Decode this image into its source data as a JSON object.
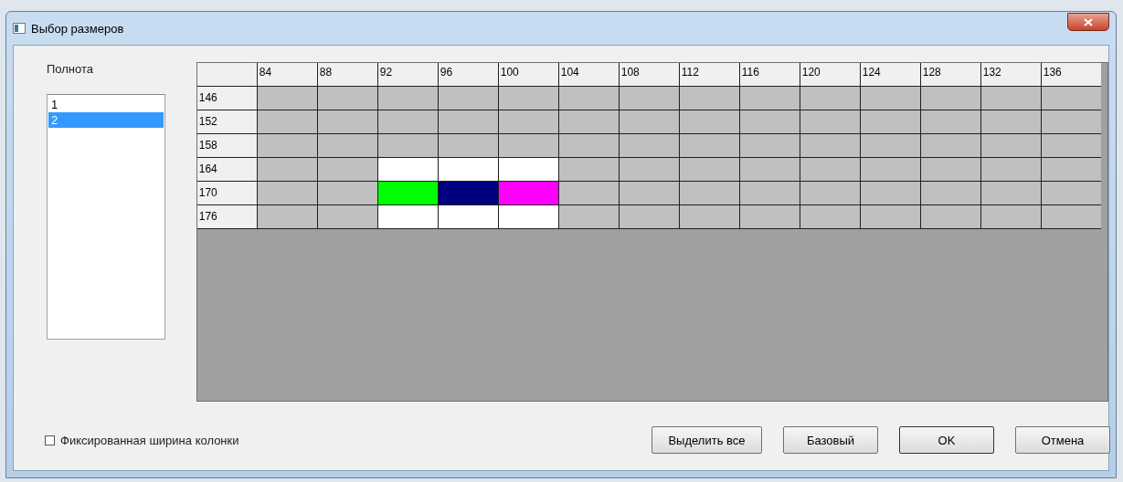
{
  "window": {
    "title": "Выбор размеров"
  },
  "fullness": {
    "label": "Полнота",
    "items": [
      {
        "label": "1",
        "selected": false
      },
      {
        "label": "2",
        "selected": true
      }
    ]
  },
  "grid": {
    "columns": [
      "84",
      "88",
      "92",
      "96",
      "100",
      "104",
      "108",
      "112",
      "116",
      "120",
      "124",
      "128",
      "132",
      "136"
    ],
    "rows": [
      {
        "label": "146",
        "cells": [
          {
            "color": "#c0c0c0"
          },
          {
            "color": "#c0c0c0"
          },
          {
            "color": "#c0c0c0"
          },
          {
            "color": "#c0c0c0"
          },
          {
            "color": "#c0c0c0"
          },
          {
            "color": "#c0c0c0"
          },
          {
            "color": "#c0c0c0"
          },
          {
            "color": "#c0c0c0"
          },
          {
            "color": "#c0c0c0"
          },
          {
            "color": "#c0c0c0"
          },
          {
            "color": "#c0c0c0"
          },
          {
            "color": "#c0c0c0"
          },
          {
            "color": "#c0c0c0"
          },
          {
            "color": "#c0c0c0"
          }
        ]
      },
      {
        "label": "152",
        "cells": [
          {
            "color": "#c0c0c0"
          },
          {
            "color": "#c0c0c0"
          },
          {
            "color": "#c0c0c0"
          },
          {
            "color": "#c0c0c0"
          },
          {
            "color": "#c0c0c0"
          },
          {
            "color": "#c0c0c0"
          },
          {
            "color": "#c0c0c0"
          },
          {
            "color": "#c0c0c0"
          },
          {
            "color": "#c0c0c0"
          },
          {
            "color": "#c0c0c0"
          },
          {
            "color": "#c0c0c0"
          },
          {
            "color": "#c0c0c0"
          },
          {
            "color": "#c0c0c0"
          },
          {
            "color": "#c0c0c0"
          }
        ]
      },
      {
        "label": "158",
        "cells": [
          {
            "color": "#c0c0c0"
          },
          {
            "color": "#c0c0c0"
          },
          {
            "color": "#c0c0c0"
          },
          {
            "color": "#c0c0c0"
          },
          {
            "color": "#c0c0c0"
          },
          {
            "color": "#c0c0c0"
          },
          {
            "color": "#c0c0c0"
          },
          {
            "color": "#c0c0c0"
          },
          {
            "color": "#c0c0c0"
          },
          {
            "color": "#c0c0c0"
          },
          {
            "color": "#c0c0c0"
          },
          {
            "color": "#c0c0c0"
          },
          {
            "color": "#c0c0c0"
          },
          {
            "color": "#c0c0c0"
          }
        ]
      },
      {
        "label": "164",
        "cells": [
          {
            "color": "#c0c0c0"
          },
          {
            "color": "#c0c0c0"
          },
          {
            "color": "#ffffff"
          },
          {
            "color": "#ffffff"
          },
          {
            "color": "#ffffff"
          },
          {
            "color": "#c0c0c0"
          },
          {
            "color": "#c0c0c0"
          },
          {
            "color": "#c0c0c0"
          },
          {
            "color": "#c0c0c0"
          },
          {
            "color": "#c0c0c0"
          },
          {
            "color": "#c0c0c0"
          },
          {
            "color": "#c0c0c0"
          },
          {
            "color": "#c0c0c0"
          },
          {
            "color": "#c0c0c0"
          }
        ]
      },
      {
        "label": "170",
        "cells": [
          {
            "color": "#c0c0c0"
          },
          {
            "color": "#c0c0c0"
          },
          {
            "color": "#00ff00"
          },
          {
            "color": "#000080"
          },
          {
            "color": "#ff00ff"
          },
          {
            "color": "#c0c0c0"
          },
          {
            "color": "#c0c0c0"
          },
          {
            "color": "#c0c0c0"
          },
          {
            "color": "#c0c0c0"
          },
          {
            "color": "#c0c0c0"
          },
          {
            "color": "#c0c0c0"
          },
          {
            "color": "#c0c0c0"
          },
          {
            "color": "#c0c0c0"
          },
          {
            "color": "#c0c0c0"
          }
        ]
      },
      {
        "label": "176",
        "cells": [
          {
            "color": "#c0c0c0"
          },
          {
            "color": "#c0c0c0"
          },
          {
            "color": "#ffffff"
          },
          {
            "color": "#ffffff"
          },
          {
            "color": "#ffffff"
          },
          {
            "color": "#c0c0c0"
          },
          {
            "color": "#c0c0c0"
          },
          {
            "color": "#c0c0c0"
          },
          {
            "color": "#c0c0c0"
          },
          {
            "color": "#c0c0c0"
          },
          {
            "color": "#c0c0c0"
          },
          {
            "color": "#c0c0c0"
          },
          {
            "color": "#c0c0c0"
          },
          {
            "color": "#c0c0c0"
          }
        ]
      }
    ]
  },
  "fixed_width": {
    "label": "Фиксированная ширина колонки",
    "checked": false
  },
  "buttons": [
    "Выделить все",
    "Базовый",
    "OK",
    "Отмена"
  ]
}
